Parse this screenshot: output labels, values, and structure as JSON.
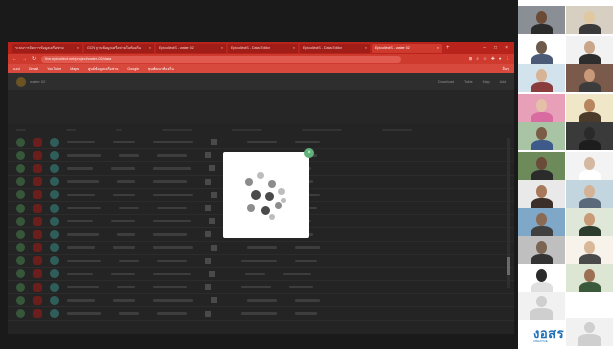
{
  "browser": {
    "tabs": [
      {
        "label": "ระบบการจัดการข้อมูลเครือข่าย",
        "active": false
      },
      {
        "label": "GCN ฐานข้อมูลเครือข่ายในท้องถิ่น",
        "active": false
      },
      {
        "label": "EpicollectS - water 02",
        "active": false
      },
      {
        "label": "EpicollectS - Data Editor",
        "active": false
      },
      {
        "label": "EpicollectS - Data Editor",
        "active": false
      },
      {
        "label": "EpicollectS - water 02",
        "active": true
      }
    ],
    "new_tab": "+",
    "window_controls": [
      "–",
      "□",
      "×"
    ],
    "url": "five.epicollect.net/project/water-02/data",
    "bookmarks": [
      "แอป",
      "Gmail",
      "YouTube",
      "Maps",
      "ศูนย์ข้อมูลเครือข่าย",
      "Google",
      "ทุนพัฒนาท้องถิ่น"
    ],
    "bookmarks_right": "อื่นๆ"
  },
  "app": {
    "title": "water 02",
    "actions": [
      "Download",
      "Table",
      "Map",
      "Add"
    ]
  },
  "modal": {
    "close_glyph": "×",
    "loading_state": "loading"
  },
  "colors": {
    "browser_accent": "#cf3a2f",
    "modal_close": "#5fb07a",
    "loader_dark": "#4a4a4a",
    "loader_mid": "#8c8c8c",
    "loader_light": "#bdbdbd"
  },
  "gallery": {
    "brand_text": "งอสร",
    "brand_subtext": "CREATIVE"
  }
}
